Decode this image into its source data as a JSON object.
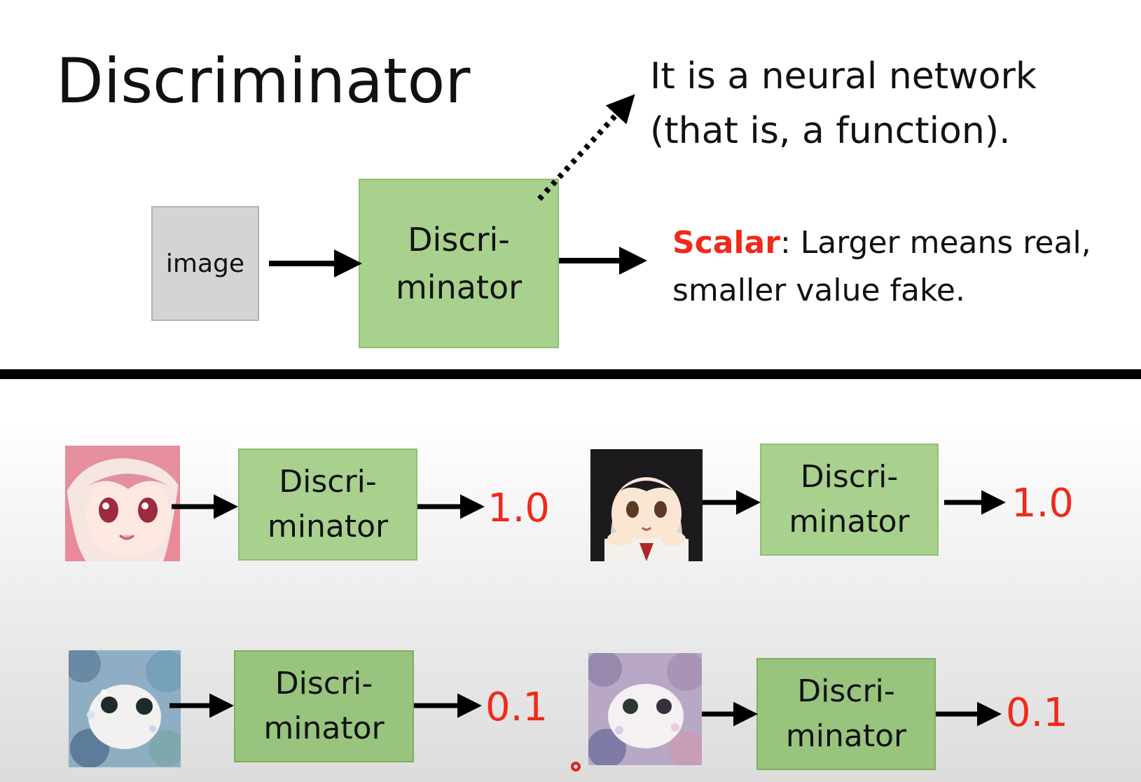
{
  "title": "Discriminator",
  "note": {
    "line1": "It is a neural network",
    "line2": "(that is, a function)."
  },
  "main_diagram": {
    "input_label": "image",
    "box_line1": "Discri-",
    "box_line2": "minator"
  },
  "output_note": {
    "keyword": "Scalar",
    "rest_line1": ": Larger means real,",
    "line2": "smaller value fake."
  },
  "examples": [
    {
      "image": "anime-girl-pink-hair-icon",
      "box_line1": "Discri-",
      "box_line2": "minator",
      "output": "1.0"
    },
    {
      "image": "anime-girl-black-hair-icon",
      "box_line1": "Discri-",
      "box_line2": "minator",
      "output": "1.0"
    },
    {
      "image": "noisy-generated-face-icon",
      "box_line1": "Discri-",
      "box_line2": "minator",
      "output": "0.1"
    },
    {
      "image": "noisy-generated-face-icon",
      "box_line1": "Discri-",
      "box_line2": "minator",
      "output": "0.1"
    }
  ],
  "colors": {
    "accent_red": "#ee2a1a",
    "box_green": "#a9d18e",
    "box_gray": "#d4d4d4"
  }
}
